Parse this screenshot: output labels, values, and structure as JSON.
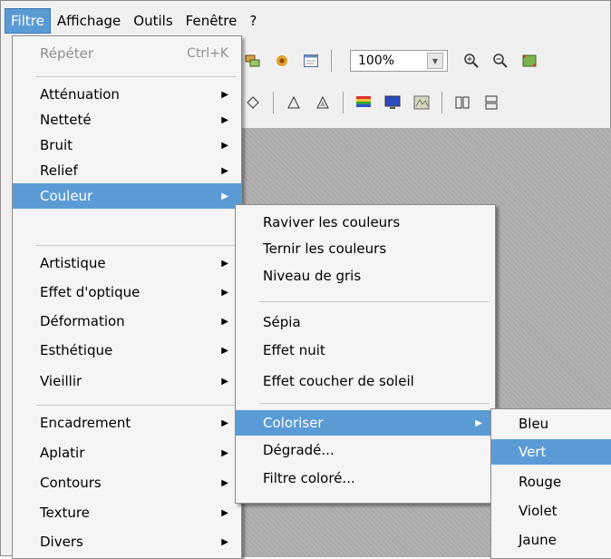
{
  "menubar": {
    "items": [
      "Filtre",
      "Affichage",
      "Outils",
      "Fenêtre",
      "?"
    ]
  },
  "toolbar": {
    "zoom": "100%"
  },
  "main_menu": {
    "repeat": {
      "label": "Répéter",
      "shortcut": "Ctrl+K"
    },
    "groups": [
      [
        "Atténuation",
        "Netteté",
        "Bruit",
        "Relief",
        "Couleur"
      ],
      [
        "Artistique",
        "Effet d'optique",
        "Déformation",
        "Esthétique",
        "Vieillir"
      ],
      [
        "Encadrement",
        "Aplatir",
        "Contours",
        "Texture",
        "Divers"
      ]
    ]
  },
  "couleur_menu": {
    "groups": [
      [
        "Raviver les couleurs",
        "Ternir les couleurs",
        "Niveau de gris"
      ],
      [
        "Sépia",
        "Effet nuit",
        "Effet coucher de soleil"
      ],
      [
        "Coloriser",
        "Dégradé...",
        "Filtre coloré..."
      ]
    ]
  },
  "coloriser_menu": {
    "items": [
      "Bleu",
      "Vert",
      "Rouge",
      "Violet",
      "Jaune"
    ]
  }
}
